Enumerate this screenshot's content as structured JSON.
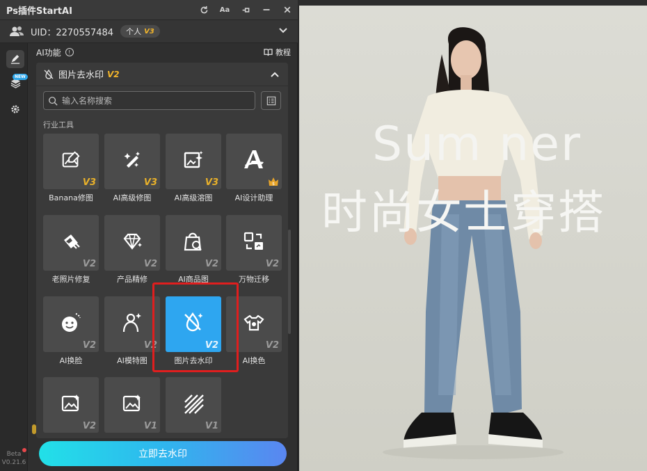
{
  "window": {
    "title": "Ps插件StartAI"
  },
  "user": {
    "uid": "UID：2270557484",
    "plan_label": "个人",
    "plan_level": "V3"
  },
  "rail": {
    "new_badge": "NEW",
    "version_label": "Beta",
    "version_number": "V0.21.6"
  },
  "ai_section": {
    "label": "AI功能",
    "tutorial_label": "教程"
  },
  "feature": {
    "title": "图片去水印",
    "version": "V2",
    "search_placeholder": "输入名称搜索",
    "category_label": "行业工具"
  },
  "tools": [
    {
      "name": "Banana修图",
      "version": "V3",
      "icon": "image-edit-icon"
    },
    {
      "name": "AI高级修图",
      "version": "V3",
      "icon": "magic-wand-icon"
    },
    {
      "name": "AI高级溶图",
      "version": "V3",
      "icon": "image-sparkle-icon"
    },
    {
      "name": "AI设计助理",
      "version": "",
      "icon": "design-a-icon"
    },
    {
      "name": "老照片修复",
      "version": "V2",
      "icon": "photo-repair-icon"
    },
    {
      "name": "产品精修",
      "version": "V2",
      "icon": "diamond-icon"
    },
    {
      "name": "AI商品图",
      "version": "V2",
      "icon": "shopping-bag-icon"
    },
    {
      "name": "万物迁移",
      "version": "V2",
      "icon": "transfer-icon"
    },
    {
      "name": "AI换脸",
      "version": "V2",
      "icon": "face-swap-icon"
    },
    {
      "name": "AI模特图",
      "version": "V2",
      "icon": "model-icon"
    },
    {
      "name": "图片去水印",
      "version": "V2",
      "icon": "watermark-remove-icon"
    },
    {
      "name": "AI换色",
      "version": "V2",
      "icon": "color-change-icon"
    },
    {
      "name": "",
      "version": "V2",
      "icon": "image-gen-icon"
    },
    {
      "name": "",
      "version": "V1",
      "icon": "image-gen-2-icon"
    },
    {
      "name": "",
      "version": "V1",
      "icon": "hatch-icon"
    }
  ],
  "cta": {
    "label": "立即去水印"
  },
  "canvas": {
    "line1": "Sum  ner",
    "line2": "时尚女士穿搭"
  },
  "colors": {
    "accent": "#2ea6f0",
    "version_gold": "#e9b12a",
    "highlight_red": "#e01e1e"
  }
}
